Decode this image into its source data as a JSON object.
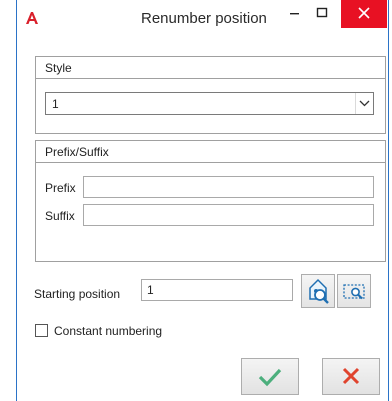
{
  "window": {
    "title": "Renumber position",
    "app_icon": "autocad-a-icon",
    "accent_color": "#2b73c7",
    "close_color": "#e81123"
  },
  "style_group": {
    "title": "Style",
    "selected_value": "1"
  },
  "prefix_suffix_group": {
    "title": "Prefix/Suffix",
    "prefix_label": "Prefix",
    "prefix_value": "",
    "suffix_label": "Suffix",
    "suffix_value": ""
  },
  "starting_position": {
    "label": "Starting position",
    "value": "1",
    "buttons": [
      "select-object-icon",
      "zoom-region-icon"
    ]
  },
  "constant_numbering": {
    "label": "Constant numbering",
    "checked": false
  },
  "actions": {
    "ok_icon": "checkmark-icon",
    "ok_color": "#4caf7d",
    "cancel_icon": "cross-icon",
    "cancel_color": "#e0442e"
  }
}
